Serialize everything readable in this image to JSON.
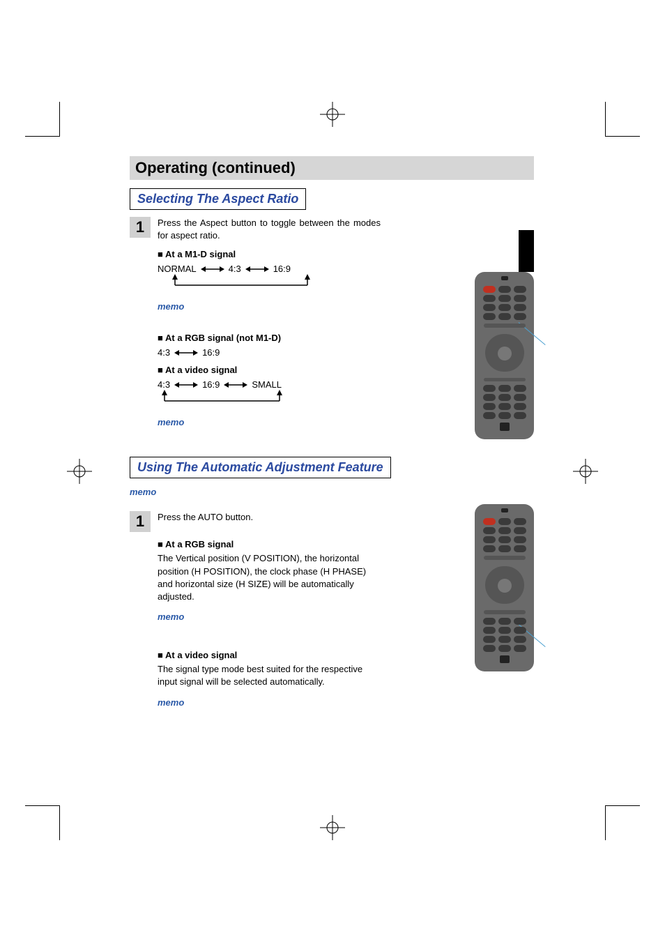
{
  "heading": "Operating (continued)",
  "section1": {
    "title": "Selecting The Aspect Ratio",
    "step": "1",
    "intro": "Press the Aspect button to toggle between the modes for aspect ratio.",
    "m1d": {
      "heading": "At a M1-D signal",
      "opt1": "NORMAL",
      "opt2": "4:3",
      "opt3": "16:9"
    },
    "memo1": "memo",
    "rgb": {
      "heading": "At a RGB signal (not M1-D)",
      "opt1": "4:3",
      "opt2": "16:9"
    },
    "video": {
      "heading": "At a video signal",
      "opt1": "4:3",
      "opt2": "16:9",
      "opt3": "SMALL"
    },
    "memo2": "memo"
  },
  "section2": {
    "title": "Using The Automatic Adjustment Feature",
    "memo_top": "memo",
    "step": "1",
    "intro": "Press the AUTO button.",
    "rgb": {
      "heading": "At a RGB signal",
      "body": "The Vertical position (V POSITION), the horizontal position (H POSITION), the clock phase (H PHASE) and horizontal size (H SIZE) will be automatically adjusted."
    },
    "memo1": "memo",
    "video": {
      "heading": "At a video signal",
      "body": "The signal type mode best suited for the respective input signal will be selected automatically."
    },
    "memo2": "memo"
  }
}
